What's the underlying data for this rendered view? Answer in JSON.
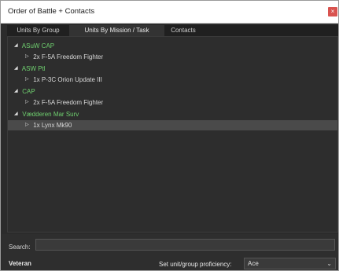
{
  "window": {
    "title": "Order of Battle + Contacts",
    "close_glyph": "×"
  },
  "tabs": [
    {
      "label": "Units By Group",
      "active": false
    },
    {
      "label": "Units By Mission / Task",
      "active": true
    },
    {
      "label": "Contacts",
      "active": false
    }
  ],
  "tree": [
    {
      "type": "group",
      "label": "ASuW CAP",
      "expanded": true
    },
    {
      "type": "unit",
      "label": "2x F-5A Freedom Fighter"
    },
    {
      "type": "group",
      "label": "ASW Ptl",
      "expanded": true
    },
    {
      "type": "unit",
      "label": "1x P-3C Orion Update III"
    },
    {
      "type": "group",
      "label": "CAP",
      "expanded": true
    },
    {
      "type": "unit",
      "label": "2x F-5A Freedom Fighter"
    },
    {
      "type": "group",
      "label": "Vædderen Mar Surv",
      "expanded": true
    },
    {
      "type": "unit",
      "label": "1x Lynx Mk90",
      "selected": true
    }
  ],
  "glyphs": {
    "expanded": "◢",
    "collapsed": "▷"
  },
  "colors": {
    "group_text": "#6fd06f",
    "background": "#2b2b2b",
    "selected_row": "#4a4a4a",
    "close_button": "#d9534f"
  },
  "search": {
    "label": "Search:",
    "value": ""
  },
  "proficiency": {
    "current_label": "Veteran",
    "set_label": "Set unit/group proficiency:",
    "selected": "Ace",
    "chevron": "⌄"
  }
}
